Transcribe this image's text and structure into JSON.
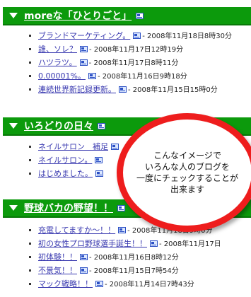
{
  "sections": [
    {
      "title": "moreな「ひとりごと」",
      "items": [
        {
          "title": "ブランドマーケティング。",
          "date": "- 2008年11月18日8時30分"
        },
        {
          "title": "誰、ソレ？",
          "date": "- 2008年11月17日12時19分"
        },
        {
          "title": "ハツラツ。",
          "date": "- 2008年11月17日8時11分"
        },
        {
          "title": "0.00001%。",
          "date": "- 2008年11月16日9時18分"
        },
        {
          "title": "連続世界新記録更新。",
          "date": "- 2008年11月15日15時0分"
        }
      ]
    },
    {
      "title": "いろどりの日々",
      "items": [
        {
          "title": "ネイルサロン　補足",
          "date": ""
        },
        {
          "title": "ネイルサロン。",
          "date": ""
        },
        {
          "title": "はじめました。",
          "date": ""
        }
      ]
    },
    {
      "title": "野球バカの野望！！",
      "items": [
        {
          "title": "充電してますか～！！",
          "date": "- 2008年11月18日9時0分"
        },
        {
          "title": "初の女性プロ野球選手誕生！！",
          "date": "- 2008年11月17日"
        },
        {
          "title": "初体験！！",
          "date": "- 2008年11月16日8時12分"
        },
        {
          "title": "不景気！！",
          "date": "- 2008年11月15日7時54分"
        },
        {
          "title": "マック戦略！！",
          "date": "- 2008年11月14日7時43分"
        }
      ]
    }
  ],
  "callout": {
    "line1": "こんなイメージで",
    "line2": "いろんな人のブログを",
    "line3": "一度にチェックすることが",
    "line4": "出来ます"
  },
  "colors": {
    "header_bg": "#0c9a0c",
    "link": "#3a3ab0",
    "callout_border": "#ee1d1d"
  },
  "icons": {
    "header_toggle": "triangle-down-icon",
    "feed": "feed-icon"
  }
}
